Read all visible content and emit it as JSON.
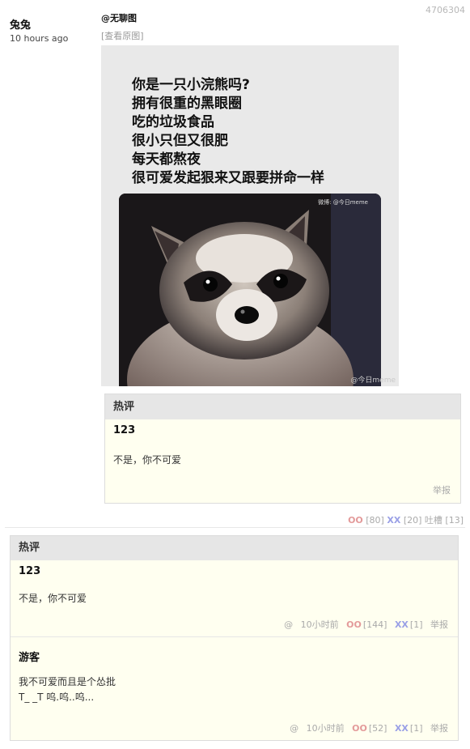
{
  "post": {
    "id": "4706304",
    "author": "兔兔",
    "time": "10 hours ago",
    "tag": "@无聊图",
    "view_original": "[查看原图]",
    "image_text_lines": [
      "你是一只小浣熊吗?",
      "拥有很重的黑眼圈",
      "吃的垃圾食品",
      "很小只但又很肥",
      "每天都熬夜",
      "很可爱发起狠来又跟要拼命一样"
    ],
    "image_watermark_top": "微博: @今日meme",
    "image_watermark_bottom": "@今日meme",
    "stats": {
      "oo_label": "OO",
      "oo_count": "[80]",
      "xx_label": "XX",
      "xx_count": "[20]",
      "tucao": "吐槽 [13]"
    }
  },
  "hot_inline": {
    "header": "热评",
    "user": "123",
    "text": "不是，你不可爱",
    "report": "举报"
  },
  "comments": {
    "header": "热评",
    "items": [
      {
        "user": "123",
        "lines": [
          "不是，你不可爱"
        ],
        "at": "@",
        "time": "10小时前",
        "oo_label": "OO",
        "oo_count": "[144]",
        "xx_label": "XX",
        "xx_count": "[1]",
        "report": "举报"
      },
      {
        "user": "游客",
        "lines": [
          "我不可爱而且是个怂批",
          "T_ _T 呜.呜..呜..."
        ],
        "at": "@",
        "time": "10小时前",
        "oo_label": "OO",
        "oo_count": "[52]",
        "xx_label": "XX",
        "xx_count": "[1]",
        "report": "举报"
      }
    ]
  },
  "colors": {
    "oo": "#e39a9a",
    "xx": "#9aa0e6",
    "comment_bg": "#fffff0",
    "header_bg": "#e6e6e6"
  }
}
